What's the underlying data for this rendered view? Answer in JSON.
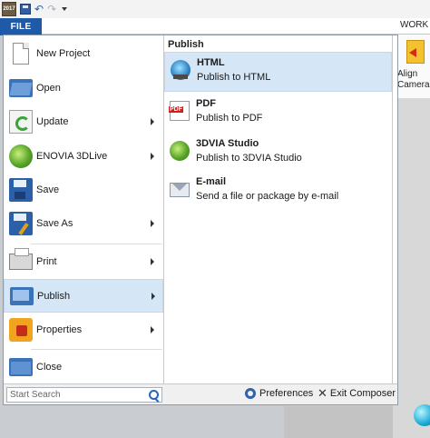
{
  "quick_access": {
    "app_icon_text": "2017",
    "icons": [
      "save-icon",
      "undo-icon",
      "redo-icon",
      "customize-dropdown-icon"
    ]
  },
  "ribbon": {
    "file_tab": "FILE",
    "work_tab": "WORK",
    "align_label": "Align Camera"
  },
  "backstage": {
    "items": [
      {
        "label": "New Project",
        "icon": "new-document-icon",
        "submenu": false
      },
      {
        "label": "Open",
        "icon": "folder-open-icon",
        "submenu": false
      },
      {
        "label": "Update",
        "icon": "update-icon",
        "submenu": true
      },
      {
        "label": "ENOVIA 3DLive",
        "icon": "enovia-globe-icon",
        "submenu": true
      },
      {
        "label": "Save",
        "icon": "save-icon",
        "submenu": false
      },
      {
        "label": "Save As",
        "icon": "save-as-icon",
        "submenu": true
      },
      {
        "label": "Print",
        "icon": "printer-icon",
        "submenu": true
      },
      {
        "label": "Publish",
        "icon": "publish-folder-icon",
        "submenu": true,
        "selected": true
      },
      {
        "label": "Properties",
        "icon": "properties-icon",
        "submenu": true
      },
      {
        "label": "Close",
        "icon": "close-folder-icon",
        "submenu": false
      }
    ]
  },
  "publish_panel": {
    "title": "Publish",
    "items": [
      {
        "title": "HTML",
        "description": "Publish to HTML",
        "icon": "html-globe-icon",
        "selected": true
      },
      {
        "title": "PDF",
        "description": "Publish to PDF",
        "icon": "pdf-document-icon"
      },
      {
        "title": "3DVIA Studio",
        "description": "Publish to 3DVIA Studio",
        "icon": "3dvia-icon"
      },
      {
        "title": "E-mail",
        "description": "Send a file or package by e-mail",
        "icon": "email-envelope-icon"
      }
    ]
  },
  "bottom_bar": {
    "search_placeholder": "Start Search",
    "preferences_label": "Preferences",
    "exit_label": "Exit Composer"
  }
}
